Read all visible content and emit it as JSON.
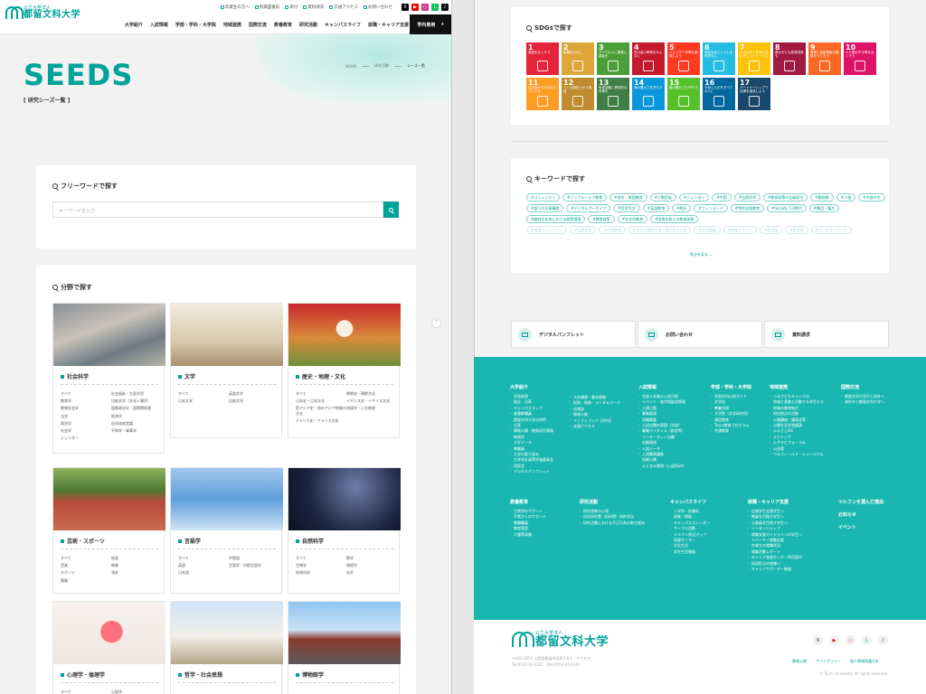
{
  "header": {
    "logo_sub": "公立大学法人",
    "logo_main": "都留文科大学",
    "utility": [
      "卒業生の方へ",
      "附属図書館",
      "寄付",
      "資料請求",
      "交通アクセス",
      "お問い合わせ"
    ],
    "nav": [
      "大学紹介",
      "入試情報",
      "学部・学科・大学院",
      "地域連携",
      "国際交流",
      "教養教育",
      "研究活動",
      "キャンパスライフ",
      "就職・キャリア支援"
    ],
    "gakunai": "学内専用",
    "gakunai_icon": "plus-icon"
  },
  "hero": {
    "title": "SEEDS",
    "subtitle": "[ 研究シーズ一覧 ]",
    "breadcrumb": [
      "HOME",
      "研究活動",
      "シーズ一覧"
    ]
  },
  "freeword": {
    "title": "フリーワードで探す",
    "placeholder": "キーワードを入力"
  },
  "fields": {
    "title": "分野で探す",
    "cards": [
      {
        "name": "社会科学",
        "subs": [
          "すべて",
          "社会福祉・生涯学習",
          "教育学",
          "比較文学（文化人類学）",
          "教育社会学",
          "国際政治学・国際関係論",
          "法学",
          "経済学",
          "政治学",
          "自治体経営論",
          "社会学",
          "平和学・軍事学",
          "ジェンダー",
          ""
        ]
      },
      {
        "name": "文学",
        "subs": [
          "すべて",
          "英語文学",
          "日本文学",
          "比較文学"
        ]
      },
      {
        "name": "歴史・地理・文化",
        "subs": [
          "すべて",
          "朝鮮史・朝鮮文化",
          "日本史・日本文化",
          "イギリス史・イギリス文化",
          "西アジア史・他のアジア地域の文化",
          "地理学・人文地理",
          "アメリカ史・アメリカ文化",
          ""
        ]
      },
      {
        "name": "芸術・スポーツ",
        "subs": [
          "すべて",
          "絵画",
          "音楽",
          "映像",
          "スポーツ",
          "演芸",
          "舞踊",
          ""
        ]
      },
      {
        "name": "言語学",
        "subs": [
          "すべて",
          "中国語",
          "英語",
          "言語学・対照言語学",
          "日本語",
          ""
        ]
      },
      {
        "name": "自然科学",
        "subs": [
          "すべて",
          "数学",
          "生物学",
          "物理学",
          "地球科学",
          "化学"
        ]
      },
      {
        "name": "心理学・倫理学",
        "subs": [
          "すべて",
          "心理学"
        ]
      },
      {
        "name": "哲学・社会思想",
        "subs": []
      },
      {
        "name": "博物館学",
        "subs": []
      }
    ]
  },
  "sdgs": {
    "title": "SDGsで探す",
    "goals": [
      {
        "n": "1",
        "t": "貧困をなくそう",
        "c": "#e5243b"
      },
      {
        "n": "2",
        "t": "飢餓をゼロに",
        "c": "#dda63a"
      },
      {
        "n": "3",
        "t": "すべての人に健康と福祉を",
        "c": "#4c9f38"
      },
      {
        "n": "4",
        "t": "質の高い教育をみんなに",
        "c": "#c5192d"
      },
      {
        "n": "5",
        "t": "ジェンダー平等を実現しよう",
        "c": "#ff3a21"
      },
      {
        "n": "6",
        "t": "安全な水とトイレを世界中に",
        "c": "#26bde2"
      },
      {
        "n": "7",
        "t": "エネルギーをみんなにそしてクリーンに",
        "c": "#fcc30b"
      },
      {
        "n": "8",
        "t": "働きがいも経済成長も",
        "c": "#a21942"
      },
      {
        "n": "9",
        "t": "産業と技術革新の基盤をつくろう",
        "c": "#fd6925"
      },
      {
        "n": "10",
        "t": "人や国の不平等をなくそう",
        "c": "#dd1367"
      },
      {
        "n": "11",
        "t": "住み続けられるまちづくりを",
        "c": "#fd9d24"
      },
      {
        "n": "12",
        "t": "つくる責任つかう責任",
        "c": "#bf8b2e"
      },
      {
        "n": "13",
        "t": "気候変動に具体的な対策を",
        "c": "#3f7e44"
      },
      {
        "n": "14",
        "t": "海の豊かさを守ろう",
        "c": "#0a97d9"
      },
      {
        "n": "15",
        "t": "陸の豊かさも守ろう",
        "c": "#56c02b"
      },
      {
        "n": "16",
        "t": "平和と公正をすべての人に",
        "c": "#00689d"
      },
      {
        "n": "17",
        "t": "パートナーシップで目標を達成しよう",
        "c": "#19486a"
      }
    ]
  },
  "keywords": {
    "title": "キーワードで探す",
    "tags": [
      "#コミュニティ",
      "#インクルーシブ教育",
      "#途労・貧困教育",
      "#少数民族",
      "#ジェンダー",
      "#中国",
      "#自然科学",
      "#教育政策の比較研究",
      "#動物館",
      "#人権",
      "#中国中世",
      "#語りの災害構造",
      "#デジタルアーカイブ",
      "#哲学文学",
      "#英語教育",
      "#統計",
      "#フィンランド",
      "#特別支援教育",
      "#Society 5.0時代",
      "#集団・権力",
      "#森林文化系における政策環境",
      "#教育政策",
      "#社会科教育",
      "#国境を超える教育改革"
    ],
    "faded": [
      "#地域コミュニティ",
      "#伝統文化",
      "#学校教育",
      "#文学と国際交流・国文化の交流",
      "#自然保護",
      "#地域デザイン",
      "#多言語",
      "#自治体",
      "#データサイエンス"
    ],
    "more": "続きを見る"
  },
  "quick": [
    {
      "label": "デジタルパンフレット",
      "icon": "pamphlet-icon"
    },
    {
      "label": "お問い合わせ",
      "icon": "mail-icon"
    },
    {
      "label": "資料請求",
      "icon": "document-icon"
    }
  ],
  "footer": {
    "cols": [
      {
        "title": "大学紹介",
        "items": [
          "学長挨拶",
          "理念・沿革",
          "キャンパスマップ",
          "各種教職員",
          "都留文科大学の特色",
          "沿革",
          "情報公開・教育研究情報",
          "新規学",
          "大学データ",
          "教職員",
          "大学の取り組み",
          "大学化計画等評価委員会",
          "同窓会",
          "デジタルパンフレット"
        ]
      },
      {
        "title": "",
        "items": [
          "大学構想・基本情報",
          "財務・税務・ランダムマーク",
          "広報誌",
          "情報公開",
          "ファクトブック【学内】",
          "交通アクセス"
        ]
      },
      {
        "title": "入試情報",
        "items": [
          "学部入学者の入試日程",
          "イベント・進学相談会情報",
          "入試日程",
          "募集要項",
          "試験概要",
          "入試出題の意図（学部）",
          "職業ガイダンス（創造等）",
          "インターネット出願",
          "出願資格",
          "入試データ",
          "入試関連講座",
          "授業公開",
          "よくある質問（入試Q&A）"
        ]
      },
      {
        "title": "学部・学科・大学院",
        "items": [
          "学部学科以前ガイド",
          "文学部",
          "教養学部",
          "大学院（文学研究科）",
          "通信教育",
          "Tsuru教育プログラム",
          "共通教育"
        ]
      },
      {
        "title": "地域連携",
        "items": [
          "つるさどもキャンパス",
          "地域と意識と活動する学生たち",
          "地域の教育拠点",
          "研究拠点の活動",
          "公開講座・講演会等",
          "公開生涯学習講演",
          "ふるさとDX",
          "よりテック",
          "ムサキビフォーラム",
          "公民館",
          "つるフィールド・ミュージアム"
        ]
      },
      {
        "title": "国際交流",
        "items": [
          "都留文科大学から海外へ",
          "海外から都留文科大学へ"
        ]
      },
      {
        "title": "教養教育",
        "items": [
          "日常学のサポート",
          "平素からのサポート",
          "教職職員",
          "教育実習",
          "介護等体験"
        ]
      },
      {
        "title": "研究活動",
        "items": [
          "研究成果の公表",
          "科学研究費（科研費）採択状況",
          "研究活動における不正行為の取り組み"
        ]
      },
      {
        "title": "キャンパスライフ",
        "items": [
          "入学料・授業料",
          "授業・教務",
          "キャンパスカレンダー",
          "サークル活動",
          "ツルフン周辺マップ",
          "保健センター",
          "学生生活",
          "学生生活情報"
        ]
      },
      {
        "title": "就職・キャリア支援",
        "items": [
          "広報学生支援学生へ",
          "教員を目指す学生へ",
          "公務員を目指す学生へ",
          "インターンシップ",
          "就職支援ガイドラインの学生へ",
          "リバーサー就職支援",
          "卒業生の就職状況",
          "就職活動レポート",
          "キャリア支援センター利用案内",
          "採用担当の皆様へ",
          "キャリアサポーター制度"
        ]
      },
      {
        "title": "ツルフンを選んだ理由",
        "items": []
      },
      {
        "title": "お知らせ",
        "items": []
      },
      {
        "title": "イベント",
        "items": []
      }
    ],
    "logo_sub": "公立大学法人",
    "logo_main": "都留文科大学",
    "address": "〒402-8555 山梨県都留市田原3-8-1　アクセス",
    "tel": "Tel:0554-43-4341　Fax:0554-43-4347",
    "links": [
      "情報公開",
      "サイトポリシー",
      "個人情報保護方針"
    ],
    "copyright": "© Tsuru University All rights reserved."
  },
  "totop": "^"
}
